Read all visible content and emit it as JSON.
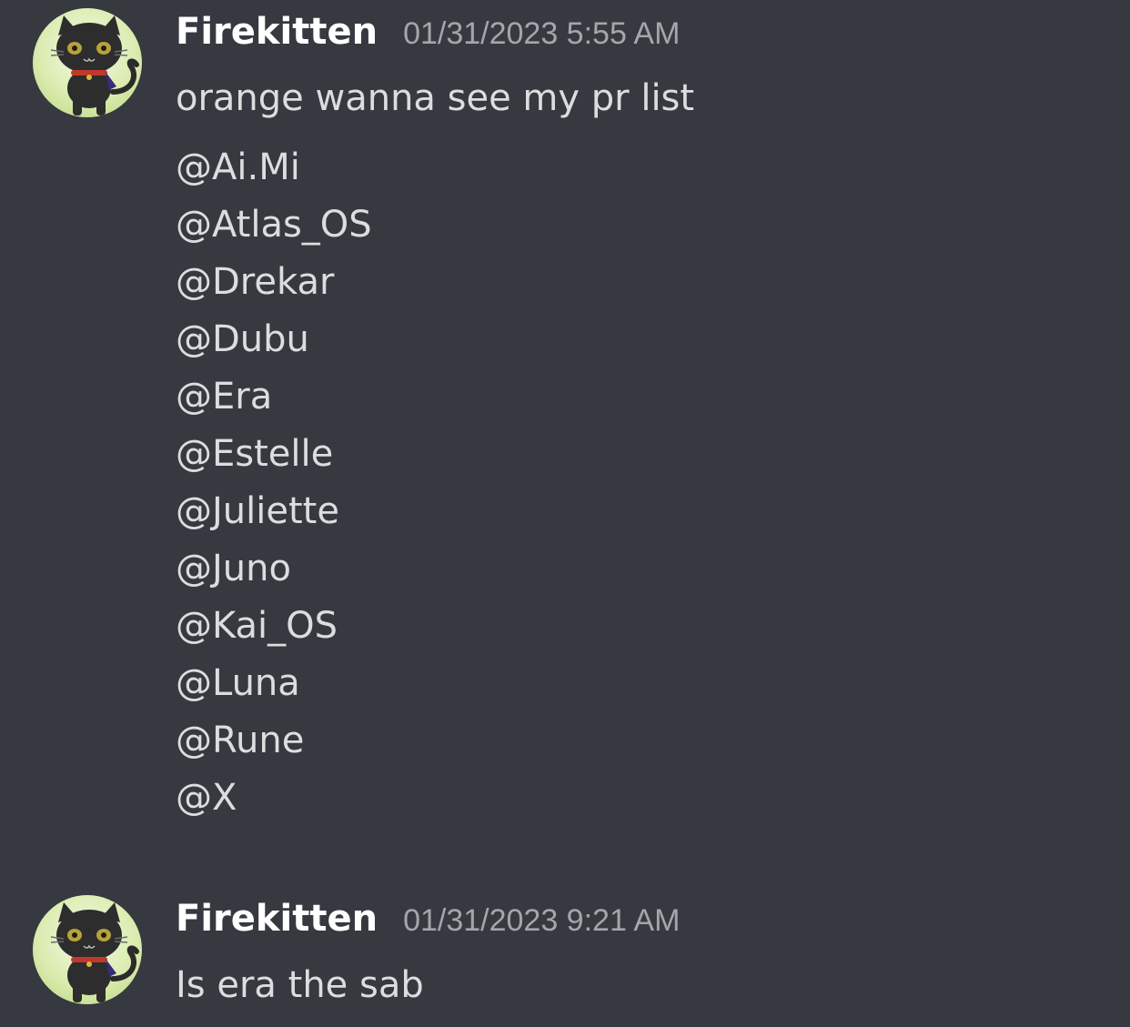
{
  "messages": [
    {
      "author": "Firekitten",
      "timestamp": "01/31/2023 5:55 AM",
      "lines": [
        "orange wanna see my pr list",
        "@Ai.Mi",
        "@Atlas_OS",
        "@Drekar",
        "@Dubu",
        "@Era",
        "@Estelle",
        "@Juliette",
        "@Juno",
        "@Kai_OS",
        "@Luna",
        "@Rune",
        "@X"
      ]
    },
    {
      "author": "Firekitten",
      "timestamp": "01/31/2023 9:21 AM",
      "lines": [
        "Is era the sab"
      ]
    }
  ],
  "colors": {
    "background": "#36393f",
    "username": "#ffffff",
    "timestamp": "#a3a6aa",
    "text": "#dcddde"
  },
  "icons": {
    "avatar": "black-cat-avatar-icon"
  }
}
